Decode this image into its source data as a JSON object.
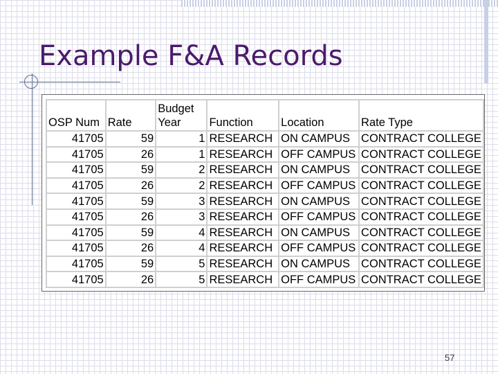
{
  "slide": {
    "title": "Example F&A Records",
    "page_number": "57"
  },
  "table": {
    "columns": [
      "OSP Num",
      "Rate",
      "Budget Year",
      "Function",
      "Location",
      "Rate Type"
    ],
    "rows": [
      [
        "41705",
        "59",
        "1",
        "RESEARCH",
        "ON CAMPUS",
        "CONTRACT COLLEGE"
      ],
      [
        "41705",
        "26",
        "1",
        "RESEARCH",
        "OFF CAMPUS",
        "CONTRACT COLLEGE"
      ],
      [
        "41705",
        "59",
        "2",
        "RESEARCH",
        "ON CAMPUS",
        "CONTRACT COLLEGE"
      ],
      [
        "41705",
        "26",
        "2",
        "RESEARCH",
        "OFF CAMPUS",
        "CONTRACT COLLEGE"
      ],
      [
        "41705",
        "59",
        "3",
        "RESEARCH",
        "ON CAMPUS",
        "CONTRACT COLLEGE"
      ],
      [
        "41705",
        "26",
        "3",
        "RESEARCH",
        "OFF CAMPUS",
        "CONTRACT COLLEGE"
      ],
      [
        "41705",
        "59",
        "4",
        "RESEARCH",
        "ON CAMPUS",
        "CONTRACT COLLEGE"
      ],
      [
        "41705",
        "26",
        "4",
        "RESEARCH",
        "OFF CAMPUS",
        "CONTRACT COLLEGE"
      ],
      [
        "41705",
        "59",
        "5",
        "RESEARCH",
        "ON CAMPUS",
        "CONTRACT COLLEGE"
      ],
      [
        "41705",
        "26",
        "5",
        "RESEARCH",
        "OFF CAMPUS",
        "CONTRACT COLLEGE"
      ]
    ]
  },
  "colors": {
    "title": "#4b1a6b",
    "grid": "#dcdcec",
    "accent_lines": "#5a6c8c"
  }
}
